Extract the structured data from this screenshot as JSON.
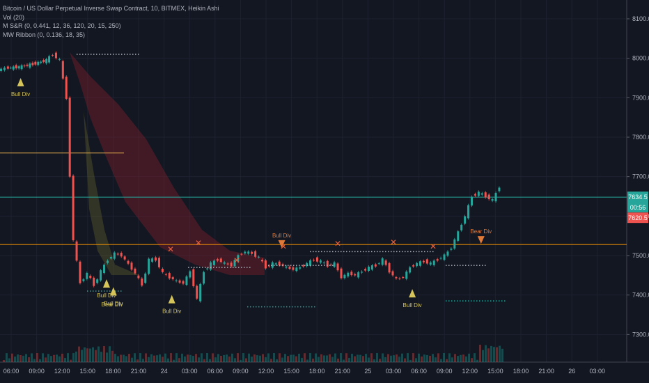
{
  "legend": {
    "title": "Bitcoin / US Dollar Perpetual Inverse Swap Contract, 10, BITMEX, Heikin Ashi",
    "vol": "Vol (20)",
    "sr": "M S&R (0, 0.441, 12, 36, 120, 20, 15, 250)",
    "ribbon": "MW Ribbon (0, 0.136, 18, 35)"
  },
  "price_axis": {
    "ticks": [
      "8100.0",
      "8000.0",
      "7900.0",
      "7800.0",
      "7700.0",
      "7600.0",
      "7500.0",
      "7400.0",
      "7300.0"
    ],
    "badges": [
      {
        "text": "7634.5",
        "color": "#26a69a"
      },
      {
        "text": "00:56",
        "color": "#26a69a"
      },
      {
        "text": "7620.5",
        "color": "#ef5350"
      }
    ]
  },
  "time_axis": {
    "ticks": [
      "06:00",
      "09:00",
      "12:00",
      "15:00",
      "18:00",
      "21:00",
      "24",
      "03:00",
      "06:00",
      "09:00",
      "12:00",
      "15:00",
      "18:00",
      "21:00",
      "25",
      "03:00",
      "06:00",
      "09:00",
      "12:00",
      "15:00",
      "18:00",
      "21:00",
      "26",
      "03:00"
    ]
  },
  "annotations": [
    {
      "text": "Bull Div"
    },
    {
      "text": "Bull Div"
    },
    {
      "text": "Bull Div"
    },
    {
      "text": "Bull Div"
    },
    {
      "text": "Bull Div"
    },
    {
      "text": "Bull Div"
    },
    {
      "text": "Bear Div"
    },
    {
      "text": "Bear Div"
    }
  ],
  "colors": {
    "bull": "#26a69a",
    "bear": "#ef5350",
    "div_bull": "#d4c45a",
    "div_bear": "#e07a3a",
    "teal_line": "#26a69a",
    "orange_line": "#ff9800"
  },
  "chart_data": {
    "type": "line",
    "x_unit": "hour since 06:00 day 23",
    "ylim": [
      7230,
      8130
    ],
    "xlim": [
      -1,
      75
    ],
    "horizontal_levels": [
      {
        "value": 7648,
        "color": "#26a69a"
      },
      {
        "value": 7528,
        "color": "#ff9800"
      }
    ],
    "series": [
      {
        "x": [
          -1,
          0,
          2,
          4,
          6,
          7,
          8,
          9,
          9.5,
          10,
          11,
          12,
          13,
          14,
          15,
          16,
          17,
          18,
          19,
          20,
          21,
          22,
          23,
          24,
          25,
          26,
          27,
          28,
          29,
          30,
          31,
          32,
          33,
          34,
          35,
          36,
          37,
          38,
          39,
          40,
          41,
          42,
          43,
          44,
          45,
          46,
          47,
          48,
          49,
          50,
          51,
          52,
          53,
          54,
          55,
          56,
          57,
          58,
          59,
          60,
          61,
          62,
          63,
          64,
          65,
          66,
          67,
          68,
          69,
          70,
          71,
          72
        ],
        "values": [
          7970,
          7975,
          7978,
          7985,
          7995,
          8010,
          7995,
          7900,
          7700,
          7540,
          7430,
          7455,
          7425,
          7460,
          7490,
          7505,
          7500,
          7478,
          7455,
          7425,
          7490,
          7490,
          7455,
          7445,
          7435,
          7430,
          7460,
          7390,
          7460,
          7480,
          7490,
          7480,
          7475,
          7500,
          7510,
          7505,
          7495,
          7470,
          7480,
          7478,
          7470,
          7465,
          7470,
          7480,
          7490,
          7485,
          7475,
          7480,
          7445,
          7455,
          7450,
          7460,
          7470,
          7475,
          7490,
          7460,
          7440,
          7445,
          7470,
          7480,
          7485,
          7480,
          7490,
          7500,
          7520,
          7560,
          7600,
          7650,
          7660,
          7650,
          7640,
          7675
        ]
      }
    ],
    "markers": [
      {
        "x": 2,
        "y": 7950,
        "kind": "bull-div"
      },
      {
        "x": 14.5,
        "y": 7440,
        "kind": "bull-div"
      },
      {
        "x": 15.5,
        "y": 7420,
        "kind": "bull-div"
      },
      {
        "x": 24,
        "y": 7400,
        "kind": "bull-div"
      },
      {
        "x": 59,
        "y": 7415,
        "kind": "bull-div"
      },
      {
        "x": 40,
        "y": 7525,
        "kind": "bear-div"
      },
      {
        "x": 69,
        "y": 7535,
        "kind": "bear-div"
      }
    ]
  }
}
